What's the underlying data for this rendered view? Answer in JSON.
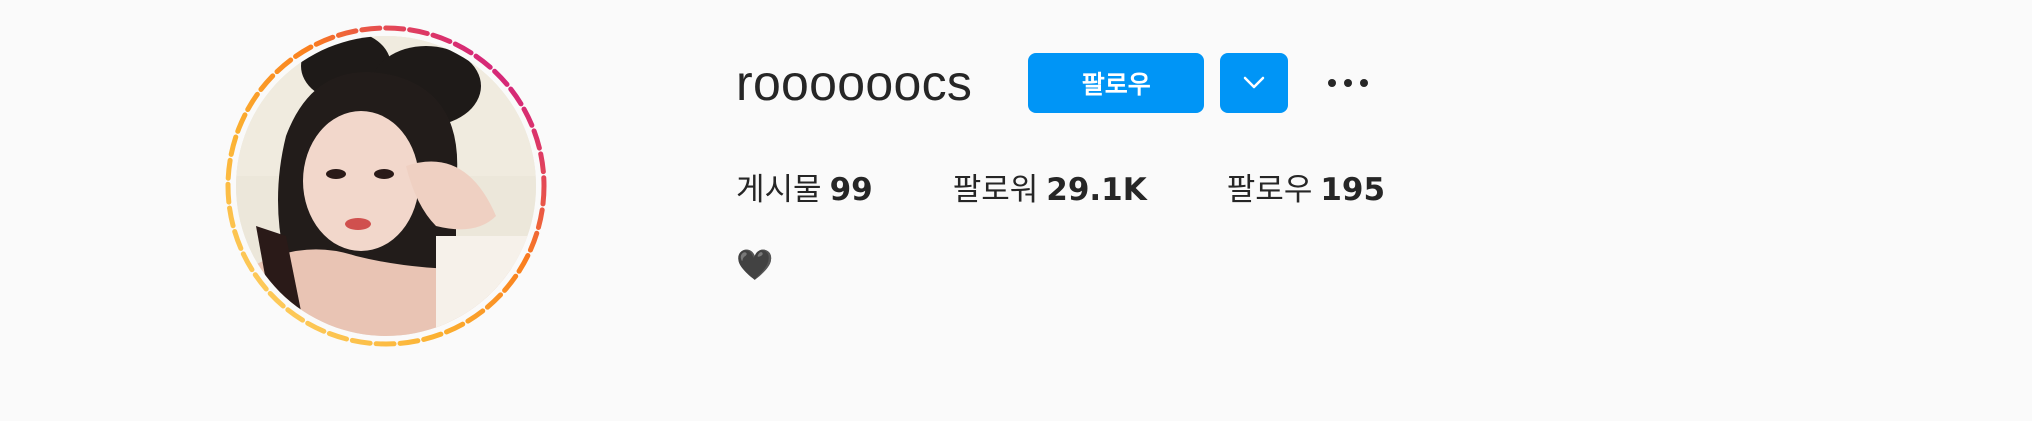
{
  "profile": {
    "username": "roooooocs",
    "follow_label": "팔로우",
    "dropdown_icon": "chevron-down-icon",
    "more_icon": "more-options-icon",
    "bio": "🖤"
  },
  "stats": [
    {
      "label": "게시물",
      "value": "99"
    },
    {
      "label": "팔로워",
      "value": "29.1K"
    },
    {
      "label": "팔로우",
      "value": "195"
    }
  ],
  "colors": {
    "primary_button": "#0095f6",
    "background": "#fafafa",
    "text": "#262626",
    "story_ring_start": "#feda75",
    "story_ring_mid": "#fa7e1e",
    "story_ring_end": "#d62976"
  }
}
